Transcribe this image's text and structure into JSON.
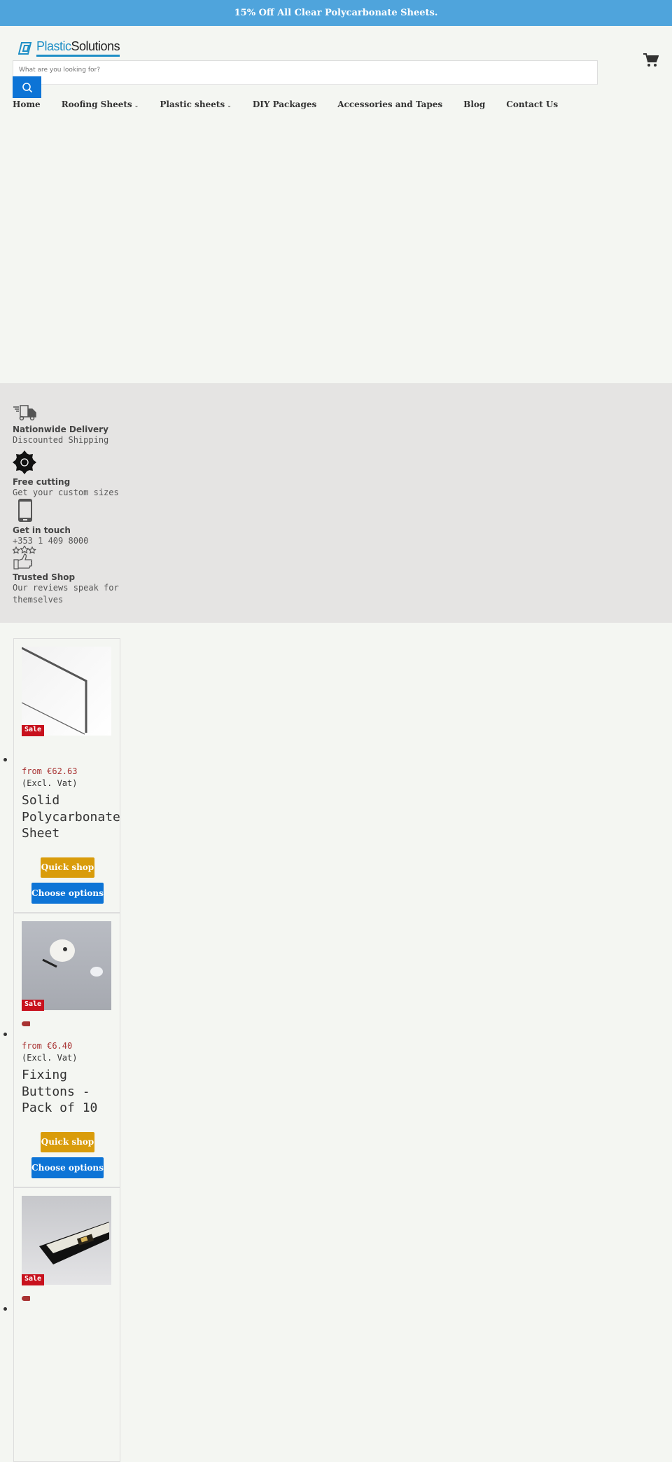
{
  "banner": {
    "text": "15% Off All Clear Polycarbonate Sheets."
  },
  "logo": {
    "part1": "Plastic",
    "part2": "Solutions"
  },
  "search": {
    "placeholder": "What are you looking for?"
  },
  "nav": {
    "items": [
      {
        "label": "Home"
      },
      {
        "label": "Roofing Sheets",
        "dropdown": true
      },
      {
        "label": "Plastic sheets",
        "dropdown": true
      },
      {
        "label": "DIY Packages"
      },
      {
        "label": "Accessories and Tapes"
      },
      {
        "label": "Blog"
      },
      {
        "label": "Contact Us"
      }
    ]
  },
  "features": [
    {
      "icon": "truck-icon",
      "title": "Nationwide Delivery",
      "subtitle": "Discounted Shipping"
    },
    {
      "icon": "saw-blade-icon",
      "title": "Free cutting",
      "subtitle": "Get your custom sizes"
    },
    {
      "icon": "phone-icon",
      "title": "Get in touch",
      "subtitle": "+353 1 409 8000"
    },
    {
      "icon": "thumbs-up-stars-icon",
      "title": "Trusted Shop",
      "subtitle": "Our reviews speak for themselves"
    }
  ],
  "products": [
    {
      "title": "Solid Polycarbonate Sheet",
      "price": "from €62.63",
      "vat": "(Excl. Vat)",
      "badge": "Sale",
      "quick_shop": "Quick shop",
      "choose": "Choose options"
    },
    {
      "title": "Fixing Buttons - Pack of 10",
      "price": "from €6.40",
      "vat": "(Excl. Vat)",
      "badge": "Sale",
      "quick_shop": "Quick shop",
      "choose": "Choose options"
    },
    {
      "badge": "Sale"
    }
  ],
  "colors": {
    "banner": "#4fa4dc",
    "primary": "#0d74d6",
    "quick_shop": "#d99c0b",
    "sale": "#c8111d",
    "price": "#a83232"
  }
}
